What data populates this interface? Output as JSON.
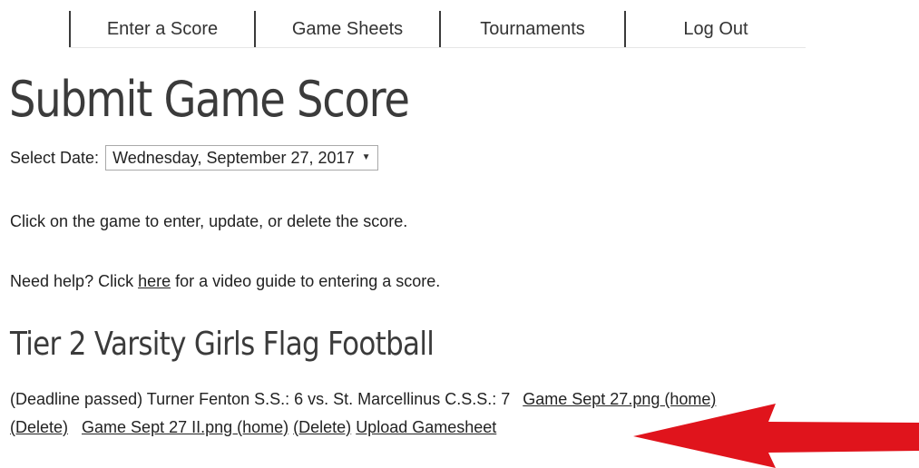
{
  "nav": {
    "items": [
      {
        "label": "Enter a Score"
      },
      {
        "label": "Game Sheets"
      },
      {
        "label": "Tournaments"
      },
      {
        "label": "Log Out"
      }
    ]
  },
  "page_title": "Submit Game Score",
  "date_select": {
    "label": "Select Date:",
    "value": "Wednesday, September 27, 2017",
    "caret": "▼"
  },
  "instructions": "Click on the game to enter, update, or delete the score.",
  "help": {
    "prefix": "Need help? Click ",
    "link": "here",
    "suffix": " for a video guide to entering a score."
  },
  "section_title": "Tier 2 Varsity Girls Flag Football",
  "game": {
    "summary": "(Deadline passed) Turner Fenton S.S.: 6 vs. St. Marcellinus C.S.S.: 7",
    "files": [
      {
        "name": "Game Sept 27.png (home)",
        "delete": "(Delete)"
      },
      {
        "name": "Game Sept 27 II.png (home)",
        "delete": "(Delete)"
      }
    ],
    "upload": "Upload Gamesheet"
  },
  "colors": {
    "arrow": "#e0141c",
    "heading": "#3b3b3b",
    "text": "#222222"
  }
}
